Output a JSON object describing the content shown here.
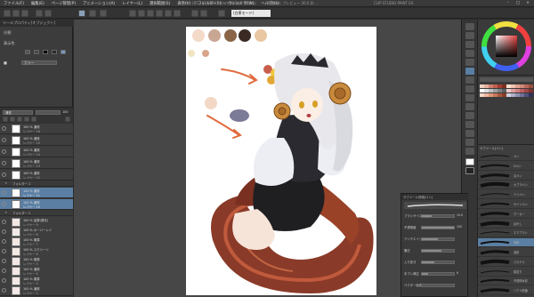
{
  "menu": [
    "ファイル(F)",
    "編集(E)",
    "ページ管理(P)",
    "アニメーション(A)",
    "レイヤー(L)",
    "選択範囲(S)",
    "表示(V)",
    "フィルター(I)",
    "ウィンドウ(W)",
    "ヘルプ(H)"
  ],
  "title": {
    "doc_info": "イラスト(B5 182.0x257.0mm 600dpi 37.8%)",
    "extra": "時間切れ プレビュー 30.0 秒 ...",
    "app": "CLIP STUDIO PAINT EX"
  },
  "command_bar": {
    "dropdown": "(白黒モード)"
  },
  "tool_property": {
    "header": "ツールプロパティ[オブジェクト]",
    "row1_label": "分割",
    "row2_label": "表示色",
    "dropdown_value": "カラー"
  },
  "layer_panel": {
    "blend_mode": "通常",
    "opacity": "100",
    "layers": [
      {
        "name": "100 % 通常",
        "sub": "レイヤー 16"
      },
      {
        "name": "100 % 通常",
        "sub": "レイヤー 15"
      },
      {
        "name": "100 % 通常",
        "sub": "レイヤー 14"
      },
      {
        "name": "100 % 通常",
        "sub": "レイヤー 13"
      },
      {
        "name": "100 % 通常",
        "sub": "レイヤー 12"
      }
    ],
    "folder1": "フォルダー 1",
    "selected_layers": [
      {
        "name": "100 % 通常",
        "sub": "レイヤー 11"
      },
      {
        "name": "100 % 通常",
        "sub": "レイヤー 10"
      }
    ],
    "folder2": "フォルダー 2",
    "lower_layers": [
      {
        "name": "100 % 加算(発光)",
        "sub": "レイヤー 9"
      },
      {
        "name": "100 % オーバーレイ",
        "sub": "レイヤー 8"
      },
      {
        "name": "100 % 乗算",
        "sub": "レイヤー 7"
      },
      {
        "name": "100 % スクリーン",
        "sub": "レイヤー 6"
      },
      {
        "name": "100 % 乗算",
        "sub": "レイヤー 5"
      },
      {
        "name": "100 % 通常",
        "sub": "レイヤー 4"
      },
      {
        "name": "100 % 乗算",
        "sub": "レイヤー 3"
      },
      {
        "name": "100 % 通常",
        "sub": "レイヤー 2"
      }
    ]
  },
  "canvas_swatches": [
    "#f3d9c8",
    "#c9a594",
    "#8a6548",
    "#3b2a24",
    "#e9c7a2",
    "#f1e4c0",
    "#d9a58a",
    "#c95f4b",
    "#f0c83c",
    "#e1a834",
    "#f3d8c6",
    "#7b7a97"
  ],
  "subtool_detail": {
    "title": "サブツール詳細[ペン]",
    "rows": [
      {
        "label": "ブラシサイズ",
        "value": "10.0",
        "level": 0.3
      },
      {
        "label": "不透明度",
        "value": "100",
        "level": 1.0
      },
      {
        "label": "アンチエイリアス",
        "value": "",
        "level": 0.5
      },
      {
        "label": "筆圧",
        "value": "",
        "level": 0.6
      },
      {
        "label": "入り抜き",
        "value": "",
        "level": 0.4
      },
      {
        "label": "手ブレ補正",
        "value": "6",
        "level": 0.2
      },
      {
        "label": "ベクター吸着",
        "value": "",
        "level": 0.0
      }
    ]
  },
  "brush_panel": {
    "title": "サブツール[ペン]",
    "brushes": [
      "ペン",
      "Gペン",
      "丸ペン",
      "カブラペン",
      "ミリペン",
      "サインペン",
      "マーカー",
      "ぼかし",
      "エアブラシ",
      "水彩",
      "油彩",
      "パステル",
      "厚塗り",
      "不透明水彩",
      "リアル鉛筆"
    ]
  },
  "palette_colors": [
    "#f0d0c0",
    "#e8b0a0",
    "#d08070",
    "#c06050",
    "#a04030",
    "#803020",
    "#f8e0d0",
    "#f0c0b0",
    "#e0a090",
    "#d08878",
    "#b86858",
    "#985040",
    "#ffffff",
    "#e0e0e0",
    "#c0c0c0",
    "#a0a0a0",
    "#808080",
    "#606060",
    "#f0c8c8",
    "#e0a0a0",
    "#d08080",
    "#c06060",
    "#a04848",
    "#803030",
    "#f8d8c8",
    "#f0b8a0",
    "#e09878",
    "#c87858",
    "#a85840",
    "#884028",
    "#d0d0e0",
    "#b0b0c8",
    "#9090b0",
    "#707098",
    "#505078",
    "#303058"
  ],
  "colors": {
    "accent": "#5b7fa3",
    "arrow": "#e06a3c"
  }
}
